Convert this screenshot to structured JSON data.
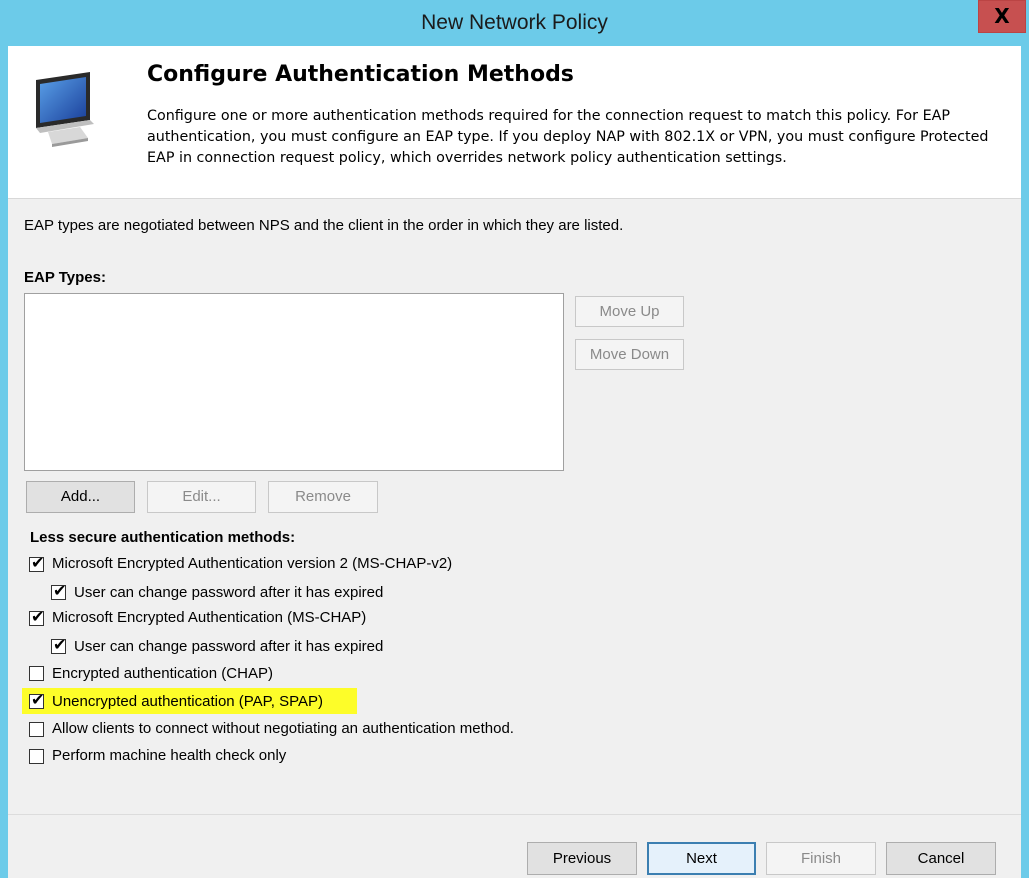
{
  "window": {
    "title": "New Network Policy",
    "close_glyph": "X"
  },
  "header": {
    "icon": "computer-monitor-icon",
    "title": "Configure Authentication Methods",
    "description": "Configure one or more authentication methods required for the connection request to match this policy. For EAP authentication, you must configure an EAP type. If you deploy NAP with 802.1X or VPN, you must configure Protected EAP in connection request policy, which overrides network policy authentication settings."
  },
  "content": {
    "intro": "EAP types are negotiated between NPS and the client in the order in which they are listed.",
    "eap_label": "EAP Types:",
    "eap_items": [],
    "buttons": {
      "move_up": "Move Up",
      "move_down": "Move Down",
      "add": "Add...",
      "edit": "Edit...",
      "remove": "Remove"
    },
    "less_secure_label": "Less secure authentication methods:",
    "methods": [
      {
        "label": "Microsoft Encrypted Authentication version 2 (MS-CHAP-v2)",
        "checked": true
      },
      {
        "label": "User can change password after it has expired",
        "checked": true
      },
      {
        "label": "Microsoft Encrypted Authentication (MS-CHAP)",
        "checked": true
      },
      {
        "label": "User can change password after it has expired",
        "checked": true
      },
      {
        "label": "Encrypted authentication (CHAP)",
        "checked": false
      },
      {
        "label": "Unencrypted authentication (PAP, SPAP)",
        "checked": true
      },
      {
        "label": "Allow clients to connect without negotiating an authentication method.",
        "checked": false
      },
      {
        "label": "Perform machine health check only",
        "checked": false
      }
    ]
  },
  "footer": {
    "previous": "Previous",
    "next": "Next",
    "finish": "Finish",
    "cancel": "Cancel"
  },
  "colors": {
    "title_bar": "#6ccbe9",
    "highlight": "#fdfd29",
    "close_button": "#c75050"
  }
}
